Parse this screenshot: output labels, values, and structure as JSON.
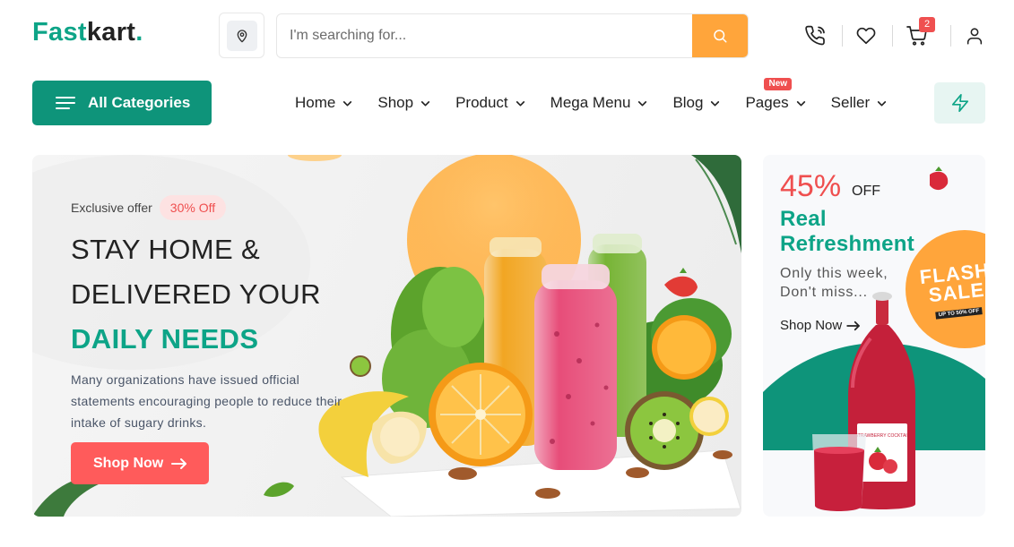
{
  "logo": {
    "part1": "Fast",
    "part2": "kart",
    "dot": "."
  },
  "search": {
    "placeholder": "I'm searching for..."
  },
  "header": {
    "cart_count": "2"
  },
  "nav": {
    "all_categories": "All Categories",
    "items": [
      {
        "label": "Home"
      },
      {
        "label": "Shop"
      },
      {
        "label": "Product"
      },
      {
        "label": "Mega Menu"
      },
      {
        "label": "Blog"
      },
      {
        "label": "Pages",
        "badge": "New"
      },
      {
        "label": "Seller"
      }
    ]
  },
  "hero": {
    "offer_label": "Exclusive offer",
    "offer_badge": "30% Off",
    "line1": "STAY HOME &",
    "line2": "DELIVERED YOUR",
    "line3": "DAILY NEEDS",
    "description": "Many organizations have issued official statements encouraging people to reduce their intake of sugary drinks.",
    "button": "Shop Now"
  },
  "side_banner": {
    "percent": "45%",
    "off": "OFF",
    "title": "Real Refreshment",
    "subtitle": "Only this week, Don't miss...",
    "link": "Shop Now",
    "flash_word1": "FLASH",
    "flash_word2": "SALE",
    "flash_small": "UP TO 50% OFF",
    "bottle_label": "STRAWBERRY COCKTAIL"
  },
  "colors": {
    "brand_green": "#0da487",
    "nav_green": "#0e947a",
    "accent_orange": "#ffa53b",
    "accent_red": "#ff5b5b",
    "badge_red": "#ef4f4f"
  },
  "icons": [
    "map-pin-icon",
    "search-icon",
    "phone-icon",
    "heart-icon",
    "cart-icon",
    "user-icon",
    "menu-icon",
    "chevron-down-icon",
    "zap-icon",
    "arrow-right-icon"
  ]
}
